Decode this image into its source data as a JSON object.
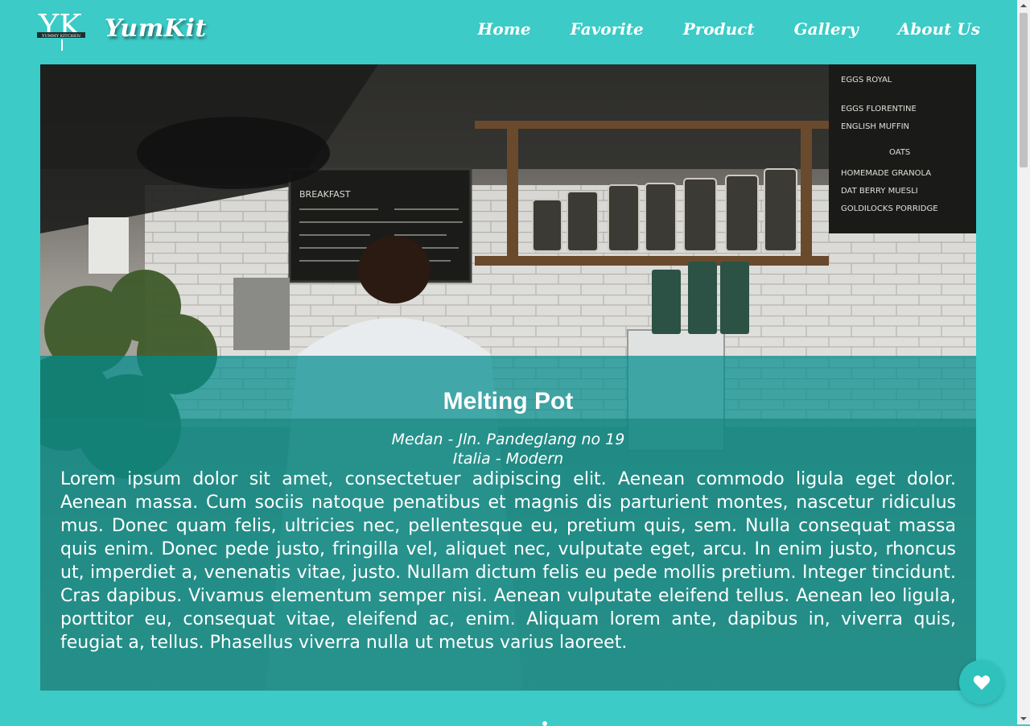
{
  "brand": {
    "logo_text": "YK",
    "logo_caption": "YUMMY KITCHEN",
    "name": "YumKit"
  },
  "nav": {
    "items": [
      {
        "label": "Home"
      },
      {
        "label": "Favorite"
      },
      {
        "label": "Product"
      },
      {
        "label": "Gallery"
      },
      {
        "label": "About Us"
      }
    ]
  },
  "hero": {
    "title": "Melting Pot",
    "location": "Medan - Jln. Pandeglang no 19",
    "cuisine": "Italia - Modern",
    "description": "Lorem ipsum dolor sit amet, consectetuer adipiscing elit. Aenean commodo ligula eget dolor. Aenean massa. Cum sociis natoque penatibus et magnis dis parturient montes, nascetur ridiculus mus. Donec quam felis, ultricies nec, pellentesque eu, pretium quis, sem. Nulla consequat massa quis enim. Donec pede justo, fringilla vel, aliquet nec, vulputate eget, arcu. In enim justo, rhoncus ut, imperdiet a, venenatis vitae, justo. Nullam dictum felis eu pede mollis pretium. Integer tincidunt. Cras dapibus. Vivamus elementum semper nisi. Aenean vulputate eleifend tellus. Aenean leo ligula, porttitor eu, consequat vitae, eleifend ac, enim. Aliquam lorem ante, dapibus in, viverra quis, feugiat a, tellus. Phasellus viverra nulla ut metus varius laoreet.",
    "menu_board_left": "BREAKFAST",
    "menu_board_right": "EGGS ROYAL",
    "menu_board_right_items": [
      "EGGS FLORENTINE",
      "ENGLISH MUFFIN",
      "OATS",
      "HOMEMADE GRANOLA",
      "DAT BERRY MUESLI",
      "GOLDILOCKS PORRIDGE"
    ]
  },
  "colors": {
    "page_bg": "#3ccbc7",
    "overlay": "#008c8c",
    "fab": "#2fc2bd"
  },
  "icons": {
    "fab": "heart-icon"
  }
}
